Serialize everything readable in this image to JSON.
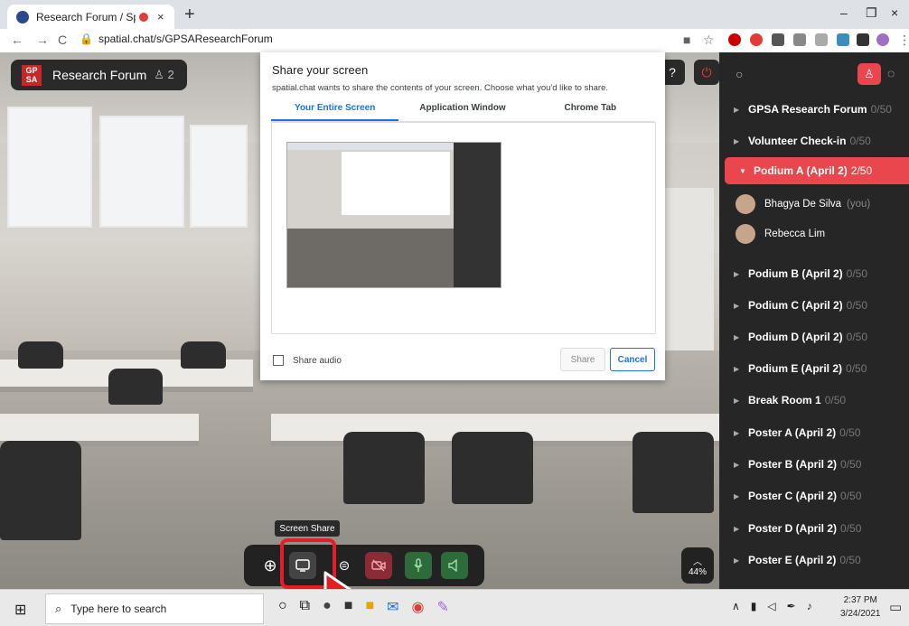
{
  "browser": {
    "tab_title": "Research Forum / SpatialCha",
    "close_glyph": "×",
    "new_tab_glyph": "+",
    "url": "spatial.chat/s/GPSAResearchForum",
    "win_min": "–",
    "win_restore": "❐",
    "win_close": "×"
  },
  "room": {
    "logo_line1": "GP",
    "logo_line2": "SA",
    "name": "Research Forum",
    "count": "2"
  },
  "dialog": {
    "title": "Share your screen",
    "subtitle": "spatial.chat wants to share the contents of your screen. Choose what you'd like to share.",
    "tabs": [
      "Your Entire Screen",
      "Application Window",
      "Chrome Tab"
    ],
    "share_audio": "Share audio",
    "share_button": "Share",
    "cancel_button": "Cancel"
  },
  "toolbar": {
    "tooltip": "Screen Share",
    "zoom": "44%"
  },
  "sidebar": {
    "rooms": [
      {
        "name": "GPSA Research Forum",
        "cap": "0/50"
      },
      {
        "name": "Volunteer Check-in",
        "cap": "0/50"
      },
      {
        "name": "Podium A (April 2)",
        "cap": "2/50"
      },
      {
        "name": "Podium B (April 2)",
        "cap": "0/50"
      },
      {
        "name": "Podium C (April 2)",
        "cap": "0/50"
      },
      {
        "name": "Podium D (April 2)",
        "cap": "0/50"
      },
      {
        "name": "Podium E (April 2)",
        "cap": "0/50"
      },
      {
        "name": "Break Room 1",
        "cap": "0/50"
      },
      {
        "name": "Poster A (April 2)",
        "cap": "0/50"
      },
      {
        "name": "Poster B (April 2)",
        "cap": "0/50"
      },
      {
        "name": "Poster C (April 2)",
        "cap": "0/50"
      },
      {
        "name": "Poster D (April 2)",
        "cap": "0/50"
      },
      {
        "name": "Poster E (April 2)",
        "cap": "0/50"
      }
    ],
    "members": [
      {
        "name": "Bhagya De Silva",
        "tag": "(you)"
      },
      {
        "name": "Rebecca Lim",
        "tag": ""
      }
    ]
  },
  "taskbar": {
    "search_placeholder": "Type here to search",
    "time": "2:37 PM",
    "date": "3/24/2021"
  },
  "colors": {
    "accent": "#e9464e",
    "highlight": "#e41e26",
    "link": "#1a73e8"
  }
}
